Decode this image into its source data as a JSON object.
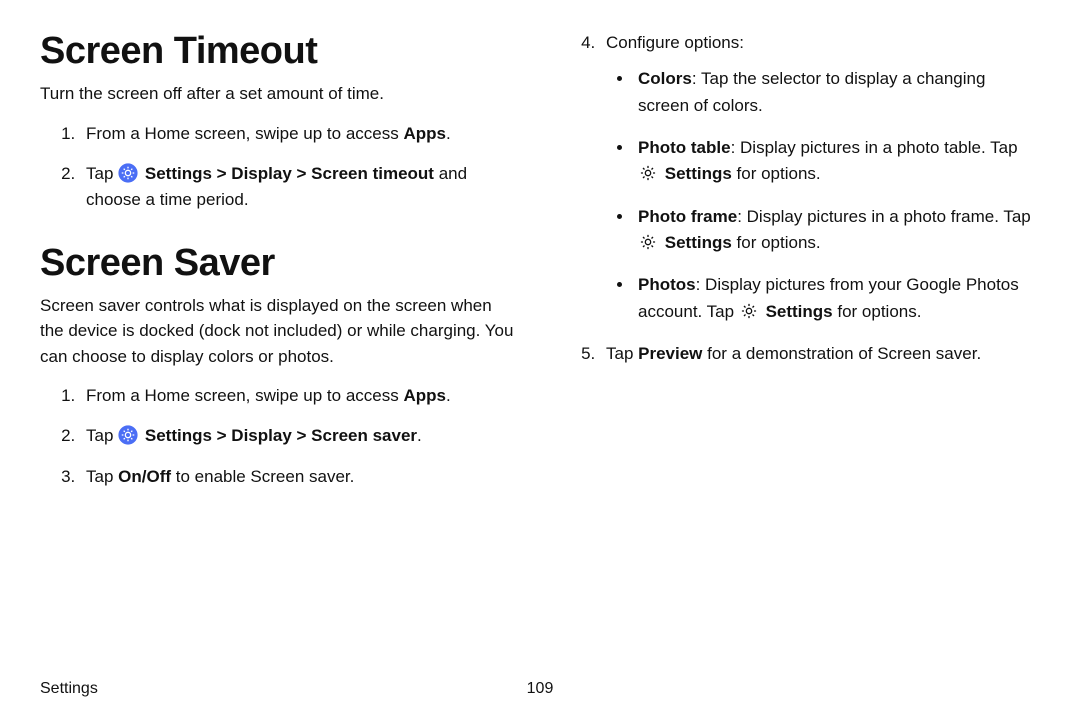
{
  "leftCol": {
    "section1": {
      "title": "Screen Timeout",
      "intro": "Turn the screen off after a set amount of time.",
      "steps": {
        "s1_pre": "From a Home screen, swipe up to access ",
        "s1_bold": "Apps",
        "s1_post": ".",
        "s2_pre": "Tap ",
        "s2_bold": "Settings > Display > Screen timeout",
        "s2_post": " and choose a time period."
      }
    },
    "section2": {
      "title": "Screen Saver",
      "intro": "Screen saver controls what is displayed on the screen when the device is docked (dock not included) or while charging. You can choose to display colors or photos.",
      "steps": {
        "s1_pre": "From a Home screen, swipe up to access ",
        "s1_bold": "Apps",
        "s1_post": ".",
        "s2_pre": "Tap ",
        "s2_bold": "Settings > Display > Screen saver",
        "s2_post": ".",
        "s3_pre": "Tap ",
        "s3_bold": "On/Off",
        "s3_post": " to enable Screen saver."
      }
    }
  },
  "rightCol": {
    "steps": {
      "s4_intro": "Configure options:",
      "bullets": {
        "b1_bold": "Colors",
        "b1_post": ": Tap the selector to display a changing screen of colors.",
        "b2_bold": "Photo table",
        "b2_mid": ": Display pictures in a photo table. Tap ",
        "b2_bold2": "Settings",
        "b2_post": " for options.",
        "b3_bold": "Photo frame",
        "b3_mid": ": Display pictures in a photo frame. Tap ",
        "b3_bold2": "Settings",
        "b3_post": " for options.",
        "b4_bold": "Photos",
        "b4_mid": ": Display pictures from your Google Photos account. Tap ",
        "b4_bold2": "Settings",
        "b4_post": " for options."
      },
      "s5_pre": "Tap ",
      "s5_bold": "Preview",
      "s5_post": " for a demonstration of Screen saver."
    }
  },
  "footer": {
    "section": "Settings",
    "page": "109"
  }
}
